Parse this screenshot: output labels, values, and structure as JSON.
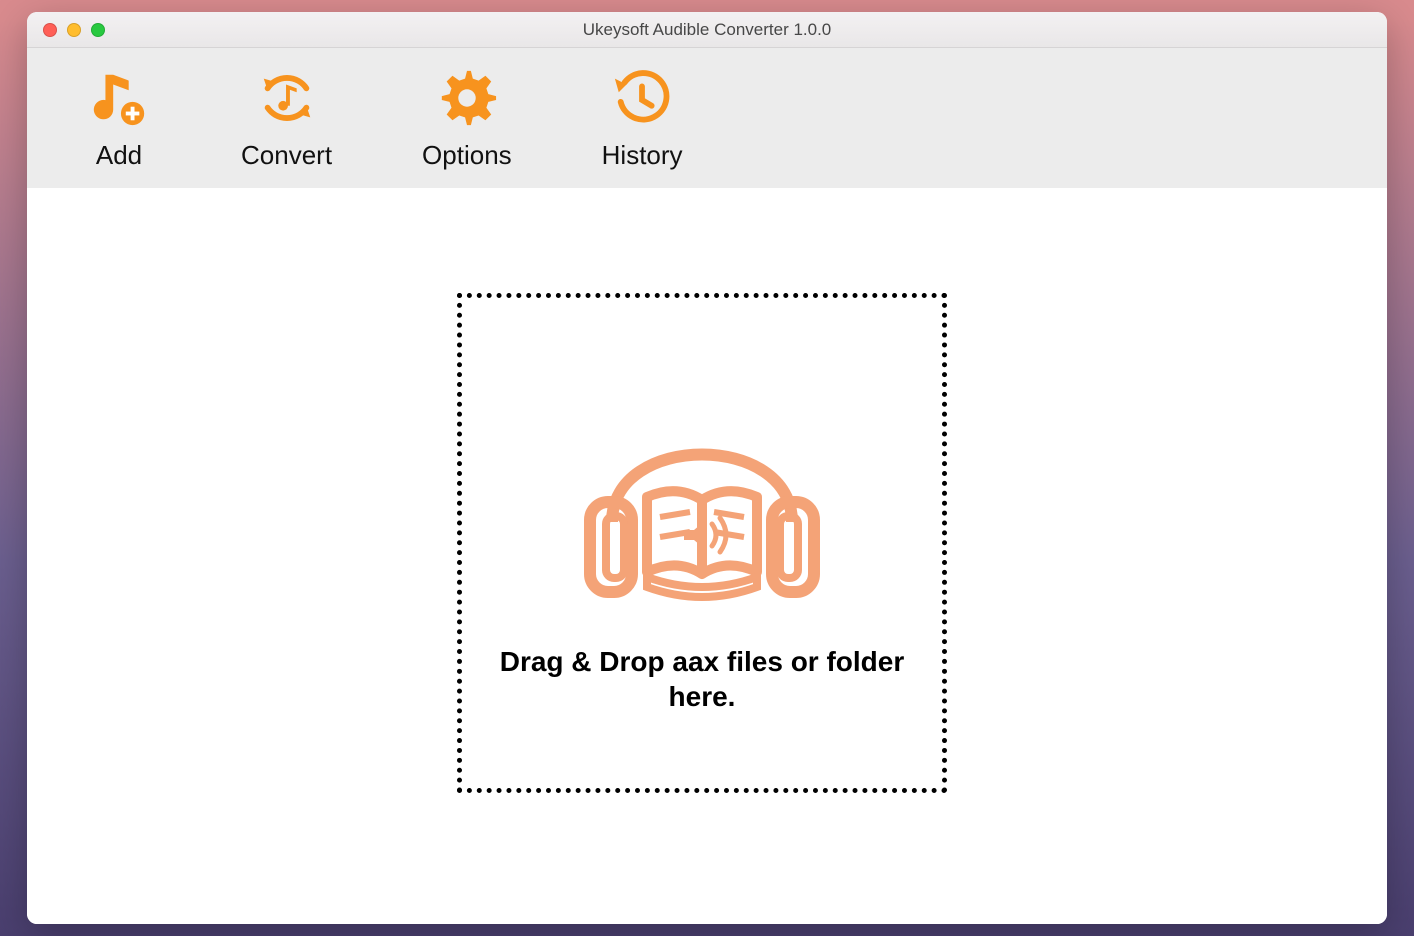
{
  "window": {
    "title": "Ukeysoft Audible Converter 1.0.0"
  },
  "toolbar": {
    "add_label": "Add",
    "convert_label": "Convert",
    "options_label": "Options",
    "history_label": "History"
  },
  "dropzone": {
    "text": "Drag & Drop aax files or folder here."
  },
  "colors": {
    "accent": "#f7931e",
    "illustration": "#f4a377"
  },
  "icons": {
    "add": "music-note-plus-icon",
    "convert": "refresh-music-icon",
    "options": "gear-icon",
    "history": "history-clock-icon",
    "dropzone": "audiobook-headphones-icon"
  }
}
